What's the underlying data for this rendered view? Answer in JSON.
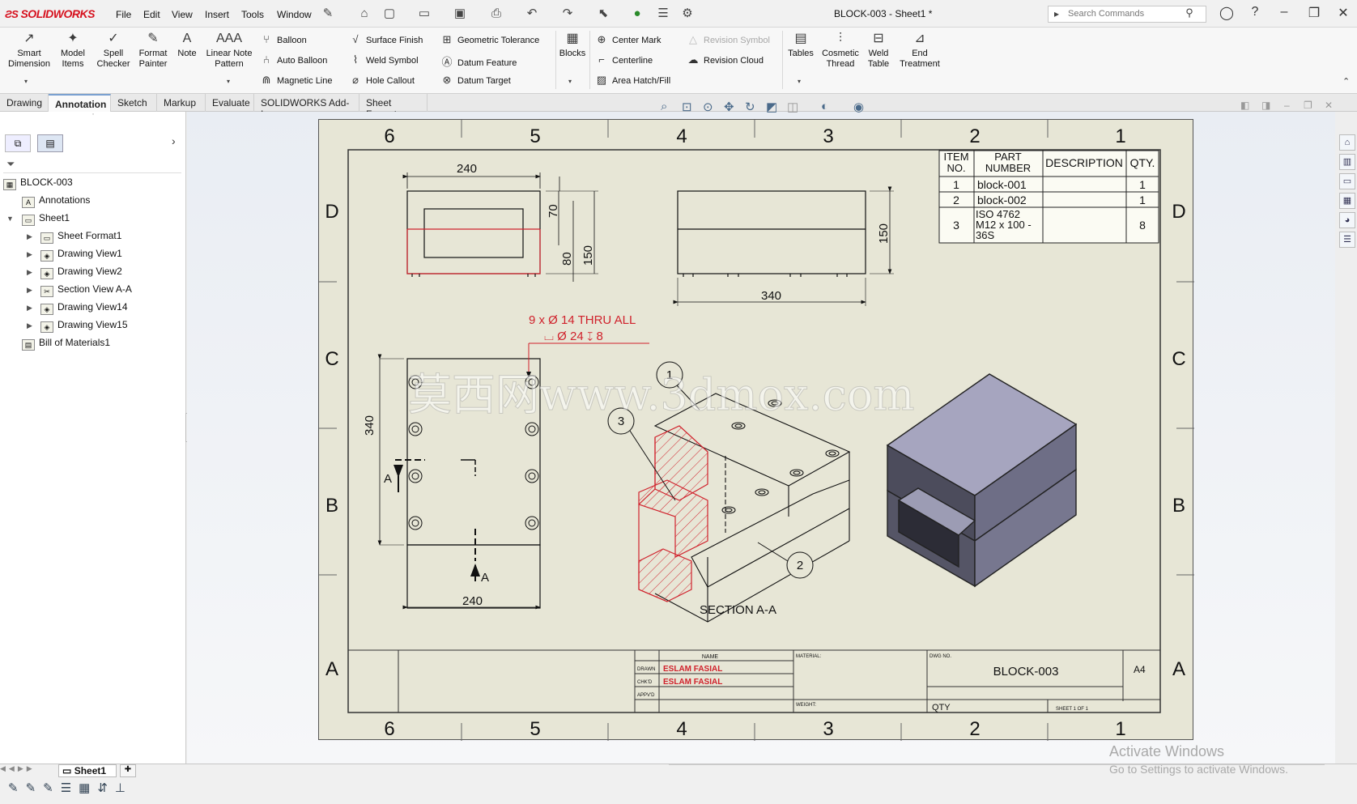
{
  "app": {
    "logo": "SOLIDWORKS",
    "window_title": "BLOCK-003 - Sheet1 *"
  },
  "menu": [
    "File",
    "Edit",
    "View",
    "Insert",
    "Tools",
    "Window"
  ],
  "search": {
    "placeholder": "Search Commands"
  },
  "ribbon": {
    "big": [
      {
        "label": "Smart Dimension",
        "icon": "smart-dimension-icon"
      },
      {
        "label": "Model Items",
        "icon": "model-items-icon"
      },
      {
        "label": "Spell Checker",
        "icon": "spell-checker-icon"
      },
      {
        "label": "Format Painter",
        "icon": "format-painter-icon"
      },
      {
        "label": "Note",
        "icon": "note-icon"
      },
      {
        "label": "Linear Note Pattern",
        "icon": "linear-note-pattern-icon"
      }
    ],
    "col1": [
      "Balloon",
      "Auto Balloon",
      "Magnetic Line"
    ],
    "col2": [
      "Surface Finish",
      "Weld Symbol",
      "Hole Callout"
    ],
    "col3": [
      "Geometric Tolerance",
      "Datum Feature",
      "Datum Target"
    ],
    "blocks": "Blocks",
    "col4": [
      "Center Mark",
      "Centerline",
      "Area Hatch/Fill"
    ],
    "col5": [
      "Revision Symbol",
      "Revision Cloud"
    ],
    "big2": [
      {
        "label": "Tables"
      },
      {
        "label": "Cosmetic Thread"
      },
      {
        "label": "Weld Table"
      },
      {
        "label": "End Treatment"
      }
    ]
  },
  "tabs": [
    "Drawing",
    "Annotation",
    "Sketch",
    "Markup",
    "Evaluate",
    "SOLIDWORKS Add-Ins",
    "Sheet Format"
  ],
  "active_tab": "Annotation",
  "tree": {
    "root": "BLOCK-003",
    "items": [
      "Annotations",
      "Sheet1",
      "Sheet Format1",
      "Drawing View1",
      "Drawing View2",
      "Section View A-A",
      "Drawing View14",
      "Drawing View15",
      "Bill of Materials1"
    ]
  },
  "sheet": {
    "zones_cols": [
      "6",
      "5",
      "4",
      "3",
      "2",
      "1"
    ],
    "zones_rows": [
      "D",
      "C",
      "B",
      "A"
    ],
    "bom": {
      "headers": [
        "ITEM NO.",
        "PART NUMBER",
        "DESCRIPTION",
        "QTY."
      ],
      "rows": [
        [
          "1",
          "block-001",
          "",
          "1"
        ],
        [
          "2",
          "block-002",
          "",
          "1"
        ],
        [
          "3",
          "ISO 4762 M12 x 100 - 36S",
          "",
          "8"
        ]
      ]
    },
    "dims": {
      "top_width": "240",
      "d70": "70",
      "d80": "80",
      "d150": "150",
      "right_150": "150",
      "right_340": "340",
      "left_340": "340",
      "bottom_240": "240"
    },
    "hole_note": {
      "line1": "9 x Ø 14 THRU ALL",
      "line2": "⌴ Ø 24 ↧ 8"
    },
    "section_label": "SECTION A-A",
    "section_marker": "A",
    "balloons": [
      "1",
      "2",
      "3"
    ],
    "watermark": "莫西网www.3dmox.com",
    "title_block": {
      "name_hdr": "NAME",
      "drawn_lbl": "DRAWN",
      "drawn": "ESLAM FASIAL",
      "chkd_lbl": "CHK'D",
      "chkd": "ESLAM FASIAL",
      "appvd_lbl": "APPV'D",
      "material_lbl": "MATERIAL:",
      "weight_lbl": "WEIGHT:",
      "dwg_lbl": "DWG NO.",
      "dwg_no": "BLOCK-003",
      "size": "A4",
      "qty": "QTY",
      "sheet_of": "SHEET 1 OF 1"
    }
  },
  "status": {
    "sheet_tab": "Sheet1",
    "activate1": "Activate Windows",
    "activate2": "Go to Settings to activate Windows."
  }
}
